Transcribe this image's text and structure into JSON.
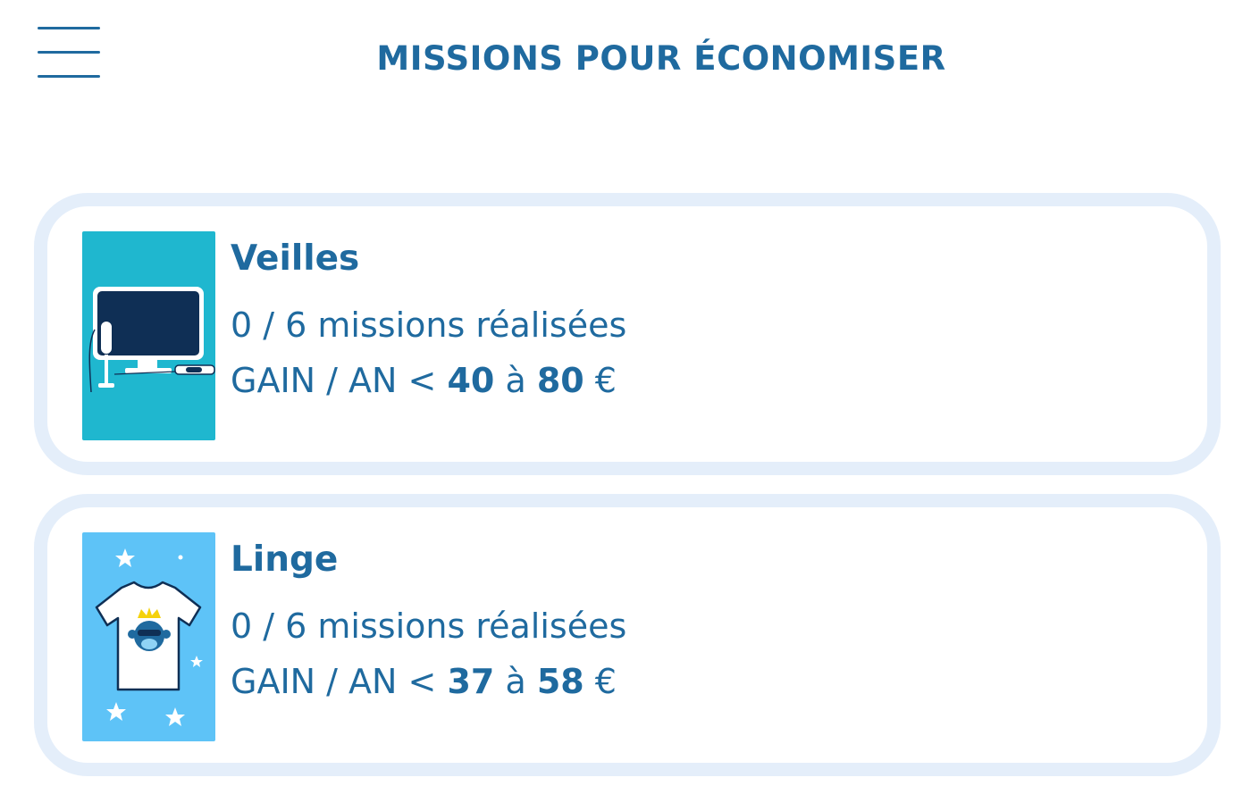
{
  "header": {
    "title": "MISSIONS POUR ÉCONOMISER",
    "menu_icon": "hamburger-menu-icon"
  },
  "colors": {
    "primary_text": "#1f6a9f",
    "card_border": "#e4eefa",
    "veilles_thumb_bg": "#1fb7cf",
    "linge_thumb_bg": "#5ec3f7"
  },
  "missions": [
    {
      "title": "Veilles",
      "progress": "0 / 6 missions réalisées",
      "gain_prefix": "GAIN / AN < ",
      "gain_min": "40",
      "gain_sep": " à ",
      "gain_max": "80",
      "gain_suffix": " €",
      "icon": "tv-standby-icon"
    },
    {
      "title": "Linge",
      "progress": "0 / 6 missions réalisées",
      "gain_prefix": "GAIN / AN < ",
      "gain_min": "37",
      "gain_sep": " à ",
      "gain_max": "58",
      "gain_suffix": " €",
      "icon": "tshirt-icon"
    }
  ]
}
